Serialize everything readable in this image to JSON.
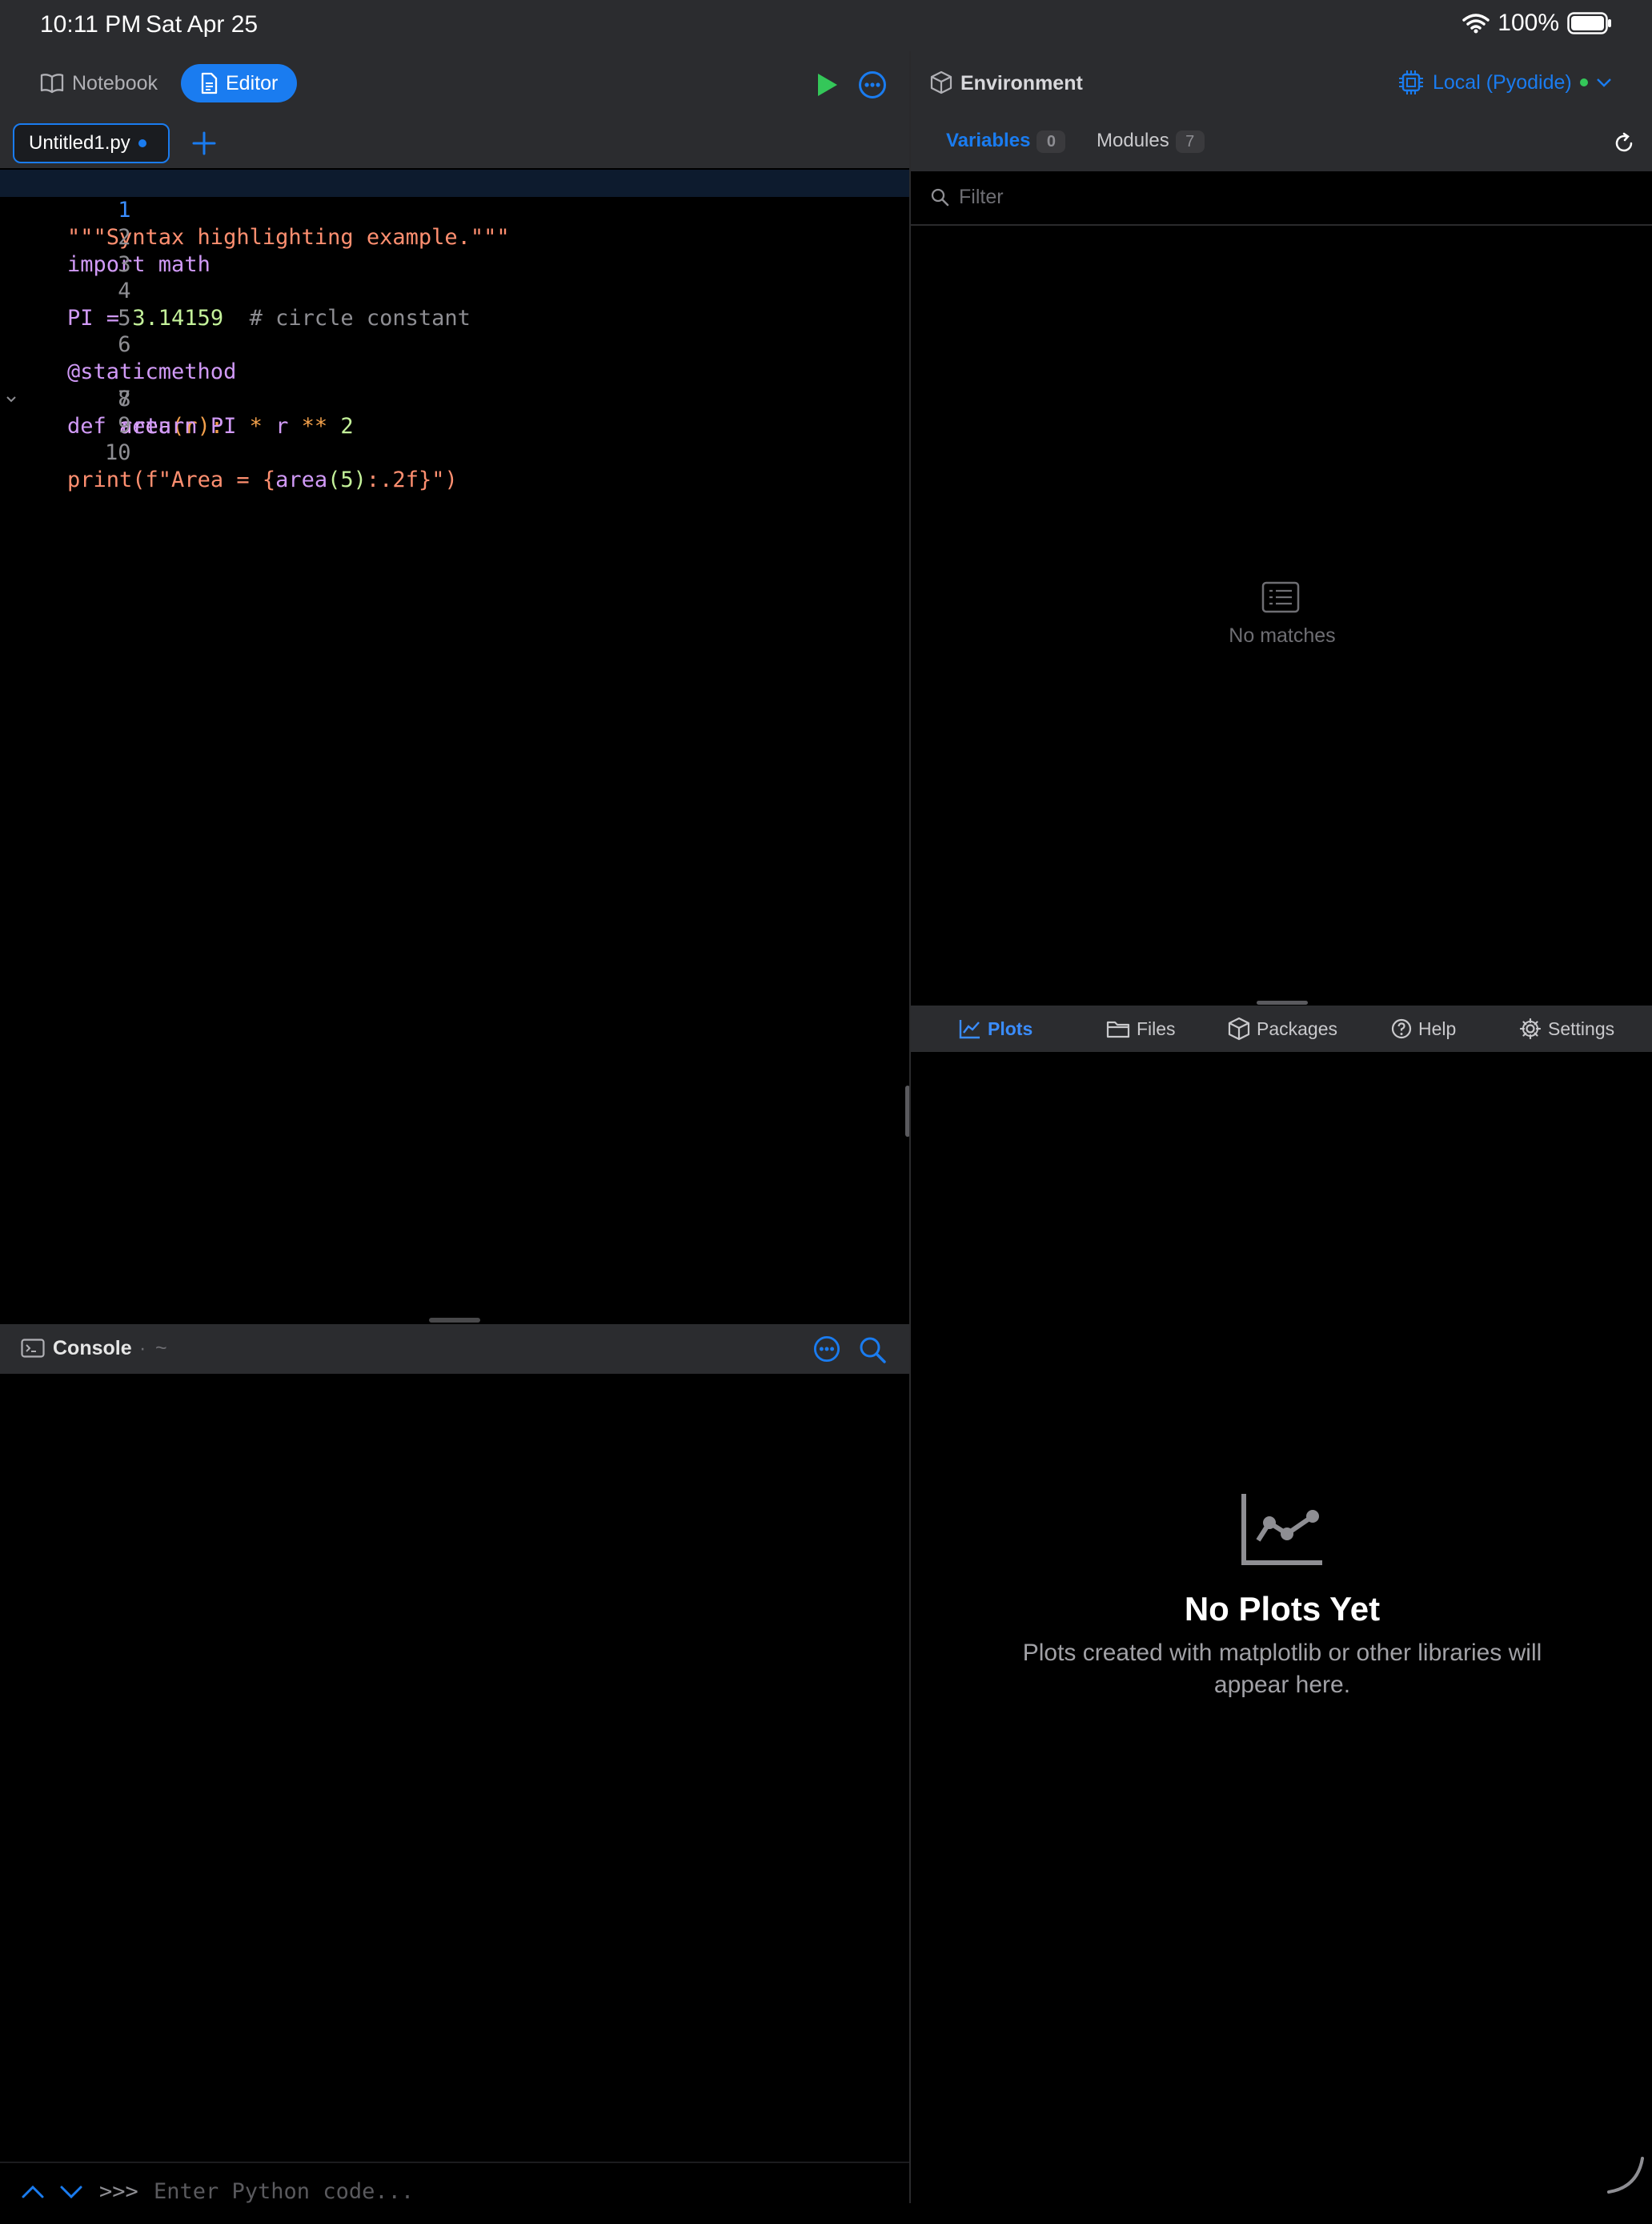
{
  "status": {
    "time": "10:11 PM",
    "date": "Sat Apr 25",
    "battery": "100%"
  },
  "toolbar": {
    "notebook_label": "Notebook",
    "editor_label": "Editor"
  },
  "file_tab": {
    "name": "Untitled1.py"
  },
  "editor": {
    "lines": [
      {
        "no": "1"
      },
      {
        "no": "2"
      },
      {
        "no": "3"
      },
      {
        "no": "4"
      },
      {
        "no": "5"
      },
      {
        "no": "6"
      },
      {
        "no": "7"
      },
      {
        "no": "8"
      },
      {
        "no": "9"
      },
      {
        "no": "10"
      }
    ],
    "tokens": {
      "l1": "\"\"\"Syntax highlighting example.\"\"\"",
      "l2_kw": "import",
      "l2_id": " math",
      "l4_id": "PI = ",
      "l4_num": "3.14159",
      "l4_cmt": "  # circle constant",
      "l6": "@staticmethod",
      "l7_kw": "def",
      "l7_fn": " area",
      "l7_paren": "(r):",
      "l8_indent": "    ",
      "l8_kw": "return",
      "l8_a": " PI ",
      "l8_op1": "*",
      "l8_b": " r ",
      "l8_op2": "**",
      "l8_num": " 2",
      "l10_fn": "print",
      "l10_p": "(",
      "l10_str1": "f\"Area = {",
      "l10_call": "area",
      "l10_num": "(5)",
      "l10_str2": ":.2f}\"",
      "l10_close": ")"
    }
  },
  "console": {
    "title": "Console",
    "sep": "·",
    "path": "~",
    "prompt": ">>>",
    "input_placeholder": "Enter Python code..."
  },
  "environment": {
    "title": "Environment",
    "runtime": "Local (Pyodide)",
    "tabs": [
      {
        "label": "Variables",
        "count": "0"
      },
      {
        "label": "Modules",
        "count": "7"
      }
    ],
    "filter_placeholder": "Filter",
    "empty_text": "No matches"
  },
  "bottom_tabs": [
    {
      "label": "Plots"
    },
    {
      "label": "Files"
    },
    {
      "label": "Packages"
    },
    {
      "label": "Help"
    },
    {
      "label": "Settings"
    }
  ],
  "plots": {
    "empty_title": "No Plots Yet",
    "empty_desc_1": "Plots created with matplotlib or other libraries will",
    "empty_desc_2": "appear here."
  },
  "colors": {
    "accent": "#1a7cf0",
    "run_green": "#34c759",
    "toolbar_bg": "#2b2c2f"
  }
}
